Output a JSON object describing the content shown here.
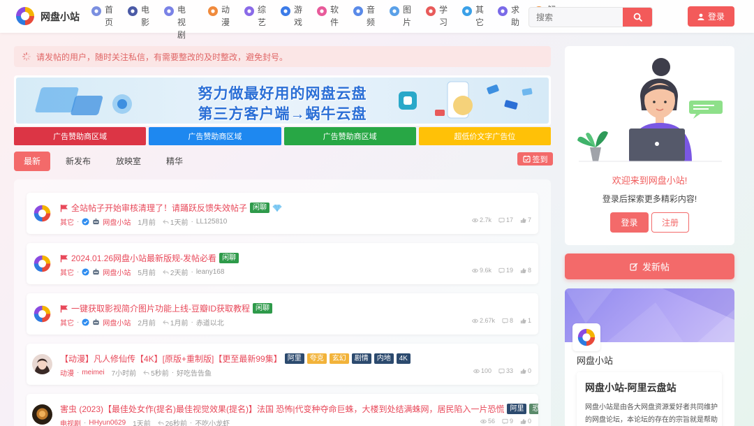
{
  "site": {
    "name": "网盘小站"
  },
  "nav": [
    {
      "label": "首页",
      "icon": "home-icon",
      "color": "#7b8fe0"
    },
    {
      "label": "电影",
      "icon": "film-reel-icon",
      "color": "#4b5aa6"
    },
    {
      "label": "电视剧",
      "icon": "tv-icon",
      "color": "#7a82e6"
    },
    {
      "label": "动漫",
      "icon": "anime-icon",
      "color": "#f08a3c"
    },
    {
      "label": "综艺",
      "icon": "play-circle-icon",
      "color": "#8a6ae8"
    },
    {
      "label": "游戏",
      "icon": "gamepad-icon",
      "color": "#3c7be8"
    },
    {
      "label": "软件",
      "icon": "software-icon",
      "color": "#e85a9a"
    },
    {
      "label": "音频",
      "icon": "audio-icon",
      "color": "#5a8ae8"
    },
    {
      "label": "图片",
      "icon": "picture-icon",
      "color": "#5aa0e8"
    },
    {
      "label": "学习",
      "icon": "study-icon",
      "color": "#e85a5a"
    },
    {
      "label": "其它",
      "icon": "paper-plane-icon",
      "color": "#3aa0e8"
    },
    {
      "label": "求助",
      "icon": "handshake-icon",
      "color": "#7a6ae8"
    },
    {
      "label": "解析",
      "icon": "parse-icon",
      "color": "#f0903c"
    }
  ],
  "search": {
    "placeholder": "搜索"
  },
  "header": {
    "login": "登录"
  },
  "notice": "请发帖的用户，随时关注私信，有需要整改的及时整改，避免封号。",
  "banner": {
    "line1": "努力做最好用的网盘云盘",
    "line2": "第三方客户端→蜗牛云盘"
  },
  "ads": [
    {
      "label": "广告赞助商区域",
      "color": "#dc3545"
    },
    {
      "label": "广告赞助商区域",
      "color": "#1e88f0"
    },
    {
      "label": "广告赞助商区域",
      "color": "#28a745"
    },
    {
      "label": "超低价文字广告位",
      "color": "#ffc107"
    }
  ],
  "tabs": [
    "最新",
    "新发布",
    "放映室",
    "精华"
  ],
  "sign": "签到",
  "posts": [
    {
      "title": "全站帖子开始审核清理了！请踊跃反馈失效帖子",
      "tags": [
        {
          "t": "闲聊",
          "c": "#2e9a4a"
        }
      ],
      "pinned": true,
      "diamond": true,
      "cat": "其它",
      "author": "网盘小站",
      "time": "1月前",
      "reply_time": "1天前",
      "last": "LL125810",
      "views": "2.7k",
      "comments": "17",
      "likes": "7",
      "avatar": "logo"
    },
    {
      "title": "2024.01.26网盘小站最新版规-发帖必看",
      "tags": [
        {
          "t": "闲聊",
          "c": "#2e9a4a"
        }
      ],
      "pinned": true,
      "cat": "其它",
      "author": "网盘小站",
      "time": "5月前",
      "reply_time": "2天前",
      "last": "leany168",
      "views": "9.6k",
      "comments": "19",
      "likes": "8",
      "avatar": "logo"
    },
    {
      "title": "一键获取影视简介图片功能上线-豆瓣ID获取教程",
      "tags": [
        {
          "t": "闲聊",
          "c": "#2e9a4a"
        }
      ],
      "pinned": true,
      "cat": "其它",
      "author": "网盘小站",
      "time": "2月前",
      "reply_time": "1月前",
      "last": "赤道以北",
      "views": "2.67k",
      "comments": "8",
      "likes": "1",
      "avatar": "logo"
    },
    {
      "title": "【动漫】凡人修仙传【4K】[原版+重制版]【更至最新99集】",
      "tags": [
        {
          "t": "阿里",
          "c": "#2c4a6e"
        },
        {
          "t": "夸克",
          "c": "#f2b33a"
        },
        {
          "t": "玄幻",
          "c": "#f2b33a"
        },
        {
          "t": "剧情",
          "c": "#2c4a6e"
        },
        {
          "t": "内地",
          "c": "#2c4a6e"
        },
        {
          "t": "4K",
          "c": "#2c4a6e"
        }
      ],
      "cat": "动漫",
      "author": "meimei",
      "time": "7小时前",
      "reply_time": "5秒前",
      "last": "好吃告告鱼",
      "views": "100",
      "comments": "33",
      "likes": "0",
      "avatar": "girl"
    },
    {
      "title": "害虫 (2023)【最佳处女作(提名)最佳视觉效果(提名)】法国 恐怖|代变种夺命巨蛛，大楼到处结满蛛网，居民陷入一片恐慌",
      "tags": [
        {
          "t": "阿里",
          "c": "#2c4a6e"
        },
        {
          "t": "恐怖",
          "c": "#5a8a6a"
        }
      ],
      "cat": "电视剧",
      "author": "HHyun0629",
      "time": "1天前",
      "reply_time": "26秒前",
      "last": "不吃小龙虾",
      "views": "56",
      "comments": "9",
      "likes": "0",
      "avatar": "dark"
    }
  ],
  "sidebar": {
    "welcome": "欢迎来到网盘小站!",
    "sub": "登录后探索更多精彩内容!",
    "login": "登录",
    "register": "注册",
    "post_button": "发新帖",
    "site_name": "网盘小站",
    "box_title": "网盘小站-阿里云盘站",
    "box_desc": "网盘小站是由各大网盘资源爱好者共同维护的网盘论坛，本论坛的存在的宗旨就是帮助"
  }
}
